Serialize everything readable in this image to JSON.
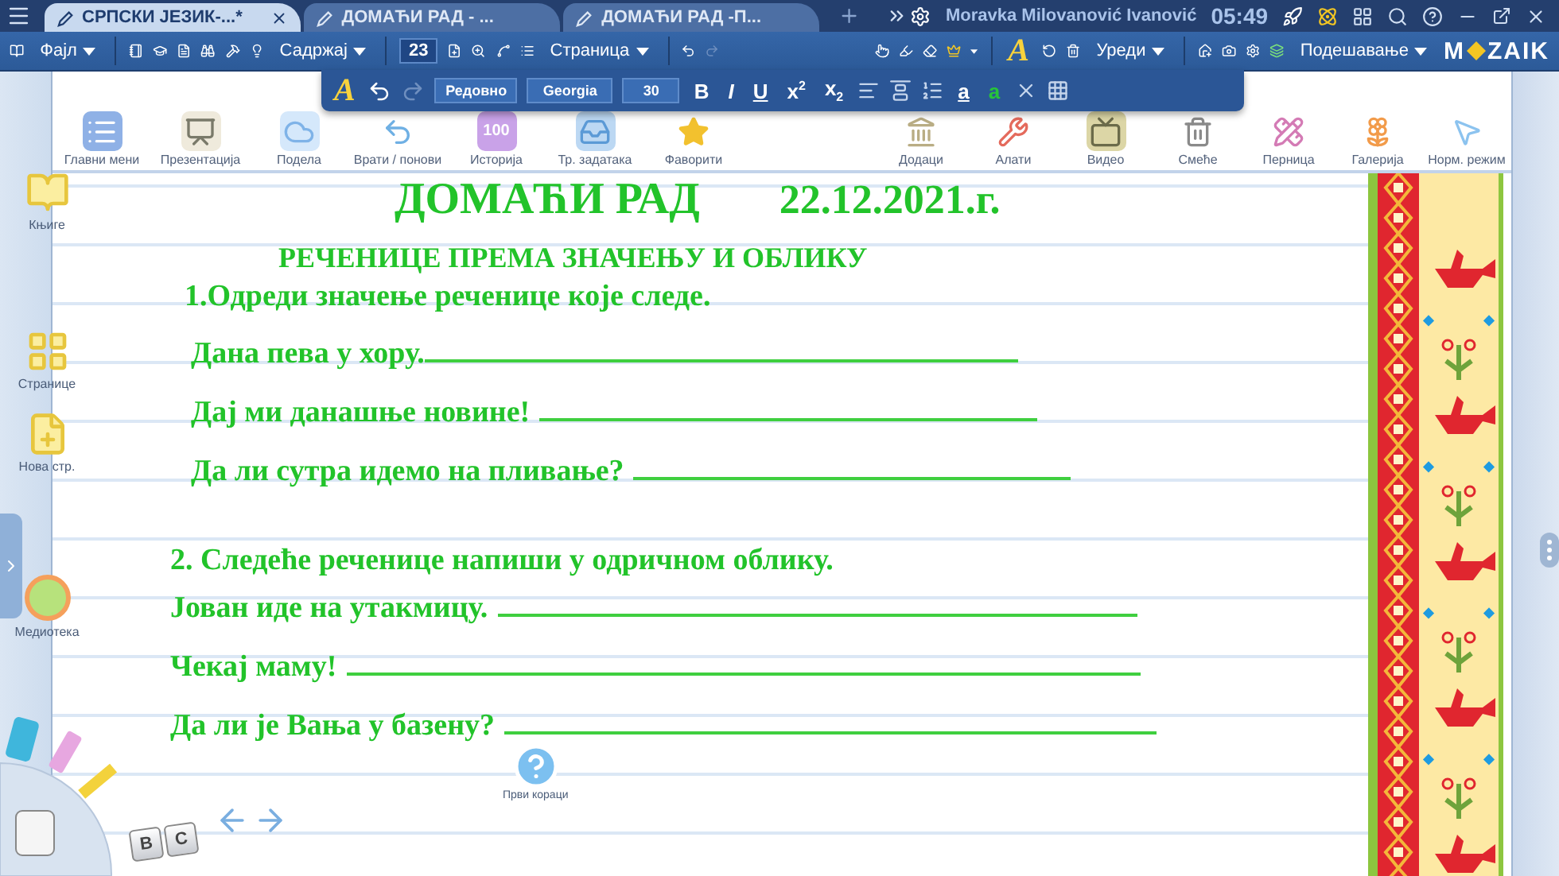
{
  "tabs": [
    {
      "label": "СРПСКИ ЈЕЗИК-...*",
      "selected": true,
      "closable": true
    },
    {
      "label": "ДОМАЋИ РАД - ...",
      "selected": false,
      "closable": false
    },
    {
      "label": "ДОМАЋИ РАД -П...",
      "selected": false,
      "closable": false
    }
  ],
  "titlebar": {
    "user": "Moravka Milovanović Ivanović",
    "time": "05:49"
  },
  "toolbar": {
    "menus": [
      "Фајл",
      "Садржај",
      "Страница",
      "Уреди",
      "Подешавање"
    ],
    "page_number": "23",
    "text_tool": "A",
    "logo": [
      "M",
      "ZAIK"
    ]
  },
  "format_bar": {
    "font_tool": "A",
    "style": "Редовно",
    "font": "Georgia",
    "size": "30",
    "styles": [
      "B",
      "I",
      "U"
    ],
    "scripts": [
      "x$^{2}$",
      "x$_{2}$"
    ],
    "colors": [
      "a",
      "a"
    ]
  },
  "launcher": {
    "left": [
      "Главни мени",
      "Презентација",
      "Подела",
      "Врати / понови",
      "Историја",
      "Тр. задатака",
      "Фаворити"
    ],
    "history_count": "100",
    "right": [
      "Додаци",
      "Алати",
      "Видео",
      "Смеће",
      "Перница",
      "Галерија",
      "Норм. режим"
    ]
  },
  "sidebar": [
    "Књиге",
    "Странице",
    "Нова стр.",
    "Медиотека"
  ],
  "document": {
    "title": "ДОМАЋИ РАД",
    "date": "22.12.2021.г.",
    "subtitle": "РЕЧЕНИЦЕ ПРЕМА ЗНАЧЕЊУ И ОБЛИКУ",
    "tasks": [
      {
        "heading": "1.Одреди значење реченице које следе.",
        "sentences": [
          "Дана пева у хору.",
          "Дај ми данашње новине!",
          "Да ли сутра идемо на пливање?"
        ]
      },
      {
        "heading": "2. Следеће реченице напиши у одричном облику.",
        "sentences": [
          "Јован иде на утакмицу.",
          "Чекај маму!",
          "Да ли је Вања у базену?"
        ]
      }
    ]
  },
  "help": {
    "label": "Први кораци"
  },
  "keys": [
    "B",
    "C"
  ]
}
